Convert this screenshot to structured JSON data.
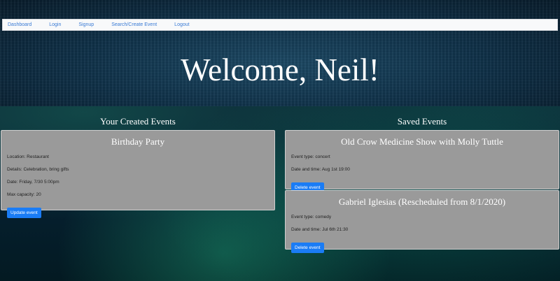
{
  "nav": {
    "items": [
      "Dashboard",
      "Login",
      "Signup",
      "Search/Create Event",
      "Logout"
    ]
  },
  "welcome": "Welcome, Neil!",
  "created": {
    "heading": "Your Created Events",
    "event": {
      "title": "Birthday Party",
      "location": "Location: Restaurant",
      "details": "Details: Celebration, bring gifts",
      "date": "Date: Friday, 7/30 5:00pm",
      "capacity": "Max capacity: 20",
      "button": "Update event"
    }
  },
  "saved": {
    "heading": "Saved Events",
    "events": [
      {
        "title": "Old Crow Medicine Show with Molly Tuttle",
        "type": "Event type: concert",
        "datetime": "Date and time: Aug 1st 19:00",
        "button": "Delete event"
      },
      {
        "title": "Gabriel Iglesias (Rescheduled from 8/1/2020)",
        "type": "Event type: comedy",
        "datetime": "Date and time: Jul 6th 21:30",
        "button": "Delete event"
      }
    ]
  }
}
